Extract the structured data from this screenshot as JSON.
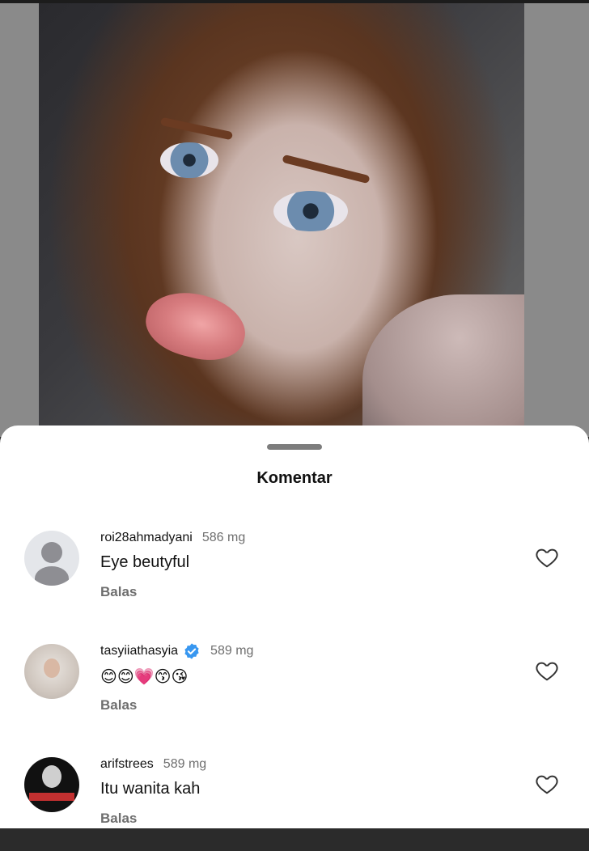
{
  "sheet": {
    "title": "Komentar"
  },
  "comments": [
    {
      "username": "roi28ahmadyani",
      "time": "586 mg",
      "text": "Eye beutyful",
      "reply": "Balas",
      "avatar": "default-avatar",
      "verified": false
    },
    {
      "username": "tasyiiathasyia",
      "time": "589 mg",
      "text": "😊😊💗😙😘",
      "reply": "Balas",
      "avatar": "photo-avatar",
      "verified": true
    },
    {
      "username": "arifstrees",
      "time": "589 mg",
      "text": "Itu wanita kah",
      "reply": "Balas",
      "avatar": "photo-avatar",
      "verified": false
    }
  ],
  "icons": {
    "like": "heart-outline-icon",
    "verified": "verified-badge-icon"
  },
  "colors": {
    "verified": "#3897f0",
    "muted": "#6e6e6e",
    "sheet": "#ffffff"
  }
}
